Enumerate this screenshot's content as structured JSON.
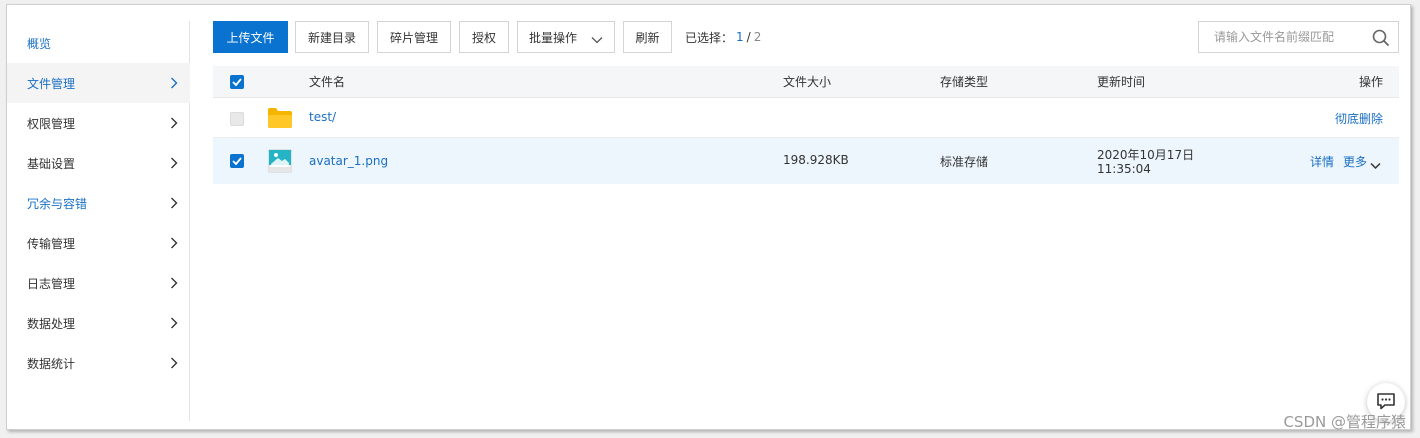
{
  "sidebar": {
    "items": [
      {
        "label": "概览",
        "has_arrow": false
      },
      {
        "label": "文件管理",
        "has_arrow": true
      },
      {
        "label": "权限管理",
        "has_arrow": true
      },
      {
        "label": "基础设置",
        "has_arrow": true
      },
      {
        "label": "冗余与容错",
        "has_arrow": true
      },
      {
        "label": "传输管理",
        "has_arrow": true
      },
      {
        "label": "日志管理",
        "has_arrow": true
      },
      {
        "label": "数据处理",
        "has_arrow": true
      },
      {
        "label": "数据统计",
        "has_arrow": true
      }
    ]
  },
  "toolbar": {
    "upload_label": "上传文件",
    "new_dir_label": "新建目录",
    "fragments_label": "碎片管理",
    "authorize_label": "授权",
    "batch_label": "批量操作",
    "refresh_label": "刷新",
    "selected_label": "已选择：",
    "selected_count": "1",
    "separator": "/",
    "total_count": "2"
  },
  "search": {
    "placeholder": "请输入文件名前缀匹配"
  },
  "table": {
    "headers": {
      "name": "文件名",
      "size": "文件大小",
      "storage": "存储类型",
      "updated": "更新时间",
      "actions": "操作"
    },
    "rows": [
      {
        "name": "test/",
        "type": "folder",
        "size": "",
        "storage": "",
        "updated_date": "",
        "updated_time": "",
        "action_delete": "彻底删除"
      },
      {
        "name": "avatar_1.png",
        "type": "image",
        "size": "198.928KB",
        "storage": "标准存储",
        "updated_date": "2020年10月17日",
        "updated_time": "11:35:04",
        "action_detail": "详情",
        "action_more": "更多"
      }
    ]
  },
  "watermark": "CSDN @管程序猿",
  "colors": {
    "accent": "#0a73d0",
    "link": "#1a6fc4",
    "folder": "#f5b400",
    "selected_row": "#eef6fd"
  }
}
